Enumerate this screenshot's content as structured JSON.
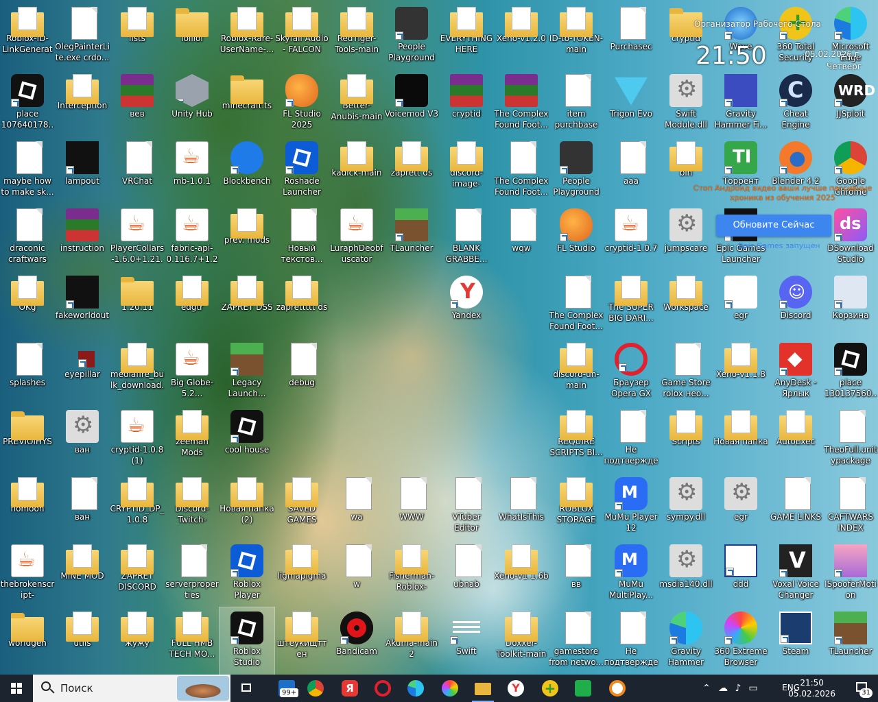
{
  "desktop": {
    "icons": [
      {
        "id": "c0r0",
        "label": "Roblox-ID-LinkGenerato...",
        "kind": "folderdoc"
      },
      {
        "id": "c0r1",
        "label": "place 107640178...",
        "kind": "roblox"
      },
      {
        "id": "c0r2",
        "label": "maybe how to make sk...",
        "kind": "file"
      },
      {
        "id": "c0r3",
        "label": "draconic craftwars",
        "kind": "file"
      },
      {
        "id": "c0r4",
        "label": "OKg",
        "kind": "folderdoc"
      },
      {
        "id": "c0r5",
        "label": "splashes",
        "kind": "file"
      },
      {
        "id": "c0r6",
        "label": "PREVIOIHYS",
        "kind": "folder"
      },
      {
        "id": "c0r7",
        "label": "nomoon",
        "kind": "folderdoc"
      },
      {
        "id": "c0r8",
        "label": "thebrokenscript-1.10.1m...",
        "kind": "java"
      },
      {
        "id": "c0r9",
        "label": "worldgen",
        "kind": "folder"
      },
      {
        "id": "c1r0",
        "label": "OlegPainterLite.exe crdo...",
        "kind": "file"
      },
      {
        "id": "c1r1",
        "label": "Interception",
        "kind": "folderdoc"
      },
      {
        "id": "c1r2",
        "label": "lampout",
        "kind": "dark"
      },
      {
        "id": "c1r3",
        "label": "instruction",
        "kind": "winrar"
      },
      {
        "id": "c1r4",
        "label": "fakeworldout",
        "kind": "dark"
      },
      {
        "id": "c1r5",
        "label": "eyepillar",
        "kind": "red"
      },
      {
        "id": "c1r6",
        "label": "ван",
        "kind": "gear"
      },
      {
        "id": "c1r7",
        "label": "ван",
        "kind": "file"
      },
      {
        "id": "c1r8",
        "label": "MINE MOD",
        "kind": "folderdoc"
      },
      {
        "id": "c1r9",
        "label": "utils",
        "kind": "folderdoc"
      },
      {
        "id": "c2r0",
        "label": "lists",
        "kind": "folderdoc"
      },
      {
        "id": "c2r1",
        "label": "вев",
        "kind": "winrar"
      },
      {
        "id": "c2r2",
        "label": "VRChat",
        "kind": "file"
      },
      {
        "id": "c2r3",
        "label": "PlayerCollars-1.6.0+1.21.4",
        "kind": "java"
      },
      {
        "id": "c2r4",
        "label": "1.20.11",
        "kind": "folder"
      },
      {
        "id": "c2r5",
        "label": "mediafire_bulk_download...",
        "kind": "folderdoc"
      },
      {
        "id": "c2r6",
        "label": "cryptid-1.0.8 (1)",
        "kind": "java"
      },
      {
        "id": "c2r7",
        "label": "CRYPTID_DP_1.0.8",
        "kind": "folderdoc"
      },
      {
        "id": "c2r8",
        "label": "ZAPRET DISCORD",
        "kind": "folderdoc"
      },
      {
        "id": "c2r9",
        "label": "жужу",
        "kind": "folderdoc"
      },
      {
        "id": "c3r0",
        "label": "lolllol",
        "kind": "folder"
      },
      {
        "id": "c3r1",
        "label": "Unity Hub",
        "kind": "unity"
      },
      {
        "id": "c3r2",
        "label": "mb-1.0.1",
        "kind": "java"
      },
      {
        "id": "c3r3",
        "label": "fabric-api-0.116.7+1.21.1",
        "kind": "java"
      },
      {
        "id": "c3r4",
        "label": "edgtr",
        "kind": "folderdoc"
      },
      {
        "id": "c3r5",
        "label": "Big Globe-5.2...",
        "kind": "java"
      },
      {
        "id": "c3r6",
        "label": "zeeman Mods",
        "kind": "folderdoc"
      },
      {
        "id": "c3r7",
        "label": "Discord-Twitch-Follow-...",
        "kind": "folderdoc"
      },
      {
        "id": "c3r8",
        "label": "serverproperties",
        "kind": "file"
      },
      {
        "id": "c3r9",
        "label": "FULL HMB TECH MO...",
        "kind": "folderdoc"
      },
      {
        "id": "c4r0",
        "label": "Roblox-Rare-UserName-...",
        "kind": "folderdoc"
      },
      {
        "id": "c4r1",
        "label": "minecraft.ts",
        "kind": "folder"
      },
      {
        "id": "c4r2",
        "label": "Blockbench",
        "kind": "blockbench"
      },
      {
        "id": "c4r3",
        "label": "prev. mods",
        "kind": "folderdoc"
      },
      {
        "id": "c4r4",
        "label": "ZAPRET DSS",
        "kind": "folderdoc"
      },
      {
        "id": "c4r5",
        "label": "Legacy Launch...",
        "kind": "mine"
      },
      {
        "id": "c4r6",
        "label": "cool house",
        "kind": "roblox"
      },
      {
        "id": "c4r7",
        "label": "Новая папка (2)",
        "kind": "folderdoc"
      },
      {
        "id": "c4r8",
        "label": "Roblox Player",
        "kind": "robloxblue"
      },
      {
        "id": "c4r9",
        "label": "Roblox Studio",
        "kind": "roblox",
        "selected": true
      },
      {
        "id": "c5r0",
        "label": "Skyfall Audio - FALCON",
        "kind": "folderdoc"
      },
      {
        "id": "c5r1",
        "label": "FL Studio 2025",
        "kind": "fl"
      },
      {
        "id": "c5r2",
        "label": "Roshade Launcher",
        "kind": "robloxblue"
      },
      {
        "id": "c5r3",
        "label": "Новый текстов...",
        "kind": "file"
      },
      {
        "id": "c5r4",
        "label": "zaprettttt ds",
        "kind": "folderdoc"
      },
      {
        "id": "c5r5",
        "label": "debug",
        "kind": "file"
      },
      {
        "id": "c5r7",
        "label": "SAVED GAMES",
        "kind": "folderdoc"
      },
      {
        "id": "c5r8",
        "label": "ligmapigma",
        "kind": "folderdoc"
      },
      {
        "id": "c5r9",
        "label": "штеукищттен",
        "kind": "folderdoc"
      },
      {
        "id": "c6r0",
        "label": "RedTiger-Tools-main",
        "kind": "folderdoc"
      },
      {
        "id": "c6r1",
        "label": "Better-Anubis-main",
        "kind": "folderdoc"
      },
      {
        "id": "c6r2",
        "label": "kadick-main",
        "kind": "folderdoc"
      },
      {
        "id": "c6r3",
        "label": "LuraphDeobfuscator",
        "kind": "java"
      },
      {
        "id": "c6r7",
        "label": "wa",
        "kind": "file"
      },
      {
        "id": "c6r8",
        "label": "w",
        "kind": "file"
      },
      {
        "id": "c6r9",
        "label": "Bandicam",
        "kind": "bandicam"
      },
      {
        "id": "c7r0",
        "label": "People Playground",
        "kind": "pp"
      },
      {
        "id": "c7r1",
        "label": "Voicemod V3",
        "kind": "voicemod"
      },
      {
        "id": "c7r2",
        "label": "zaprett ds",
        "kind": "folderdoc"
      },
      {
        "id": "c7r3",
        "label": "TLauncher",
        "kind": "mine"
      },
      {
        "id": "c7r7",
        "label": "WWW",
        "kind": "file"
      },
      {
        "id": "c7r8",
        "label": "Fisherman-Roblox-doxe...",
        "kind": "folderdoc"
      },
      {
        "id": "c7r9",
        "label": "Akuma-main 2",
        "kind": "folderdoc"
      },
      {
        "id": "c8r0",
        "label": "EVERYTHING HERE",
        "kind": "folderdoc"
      },
      {
        "id": "c8r1",
        "label": "cryptid",
        "kind": "winrar"
      },
      {
        "id": "c8r2",
        "label": "discord-image-logger-m...",
        "kind": "folderdoc"
      },
      {
        "id": "c8r3",
        "label": "BLANK GRABBE...",
        "kind": "file"
      },
      {
        "id": "c8r4",
        "label": "Yandex",
        "kind": "yandex"
      },
      {
        "id": "c8r7",
        "label": "VTuber Editor",
        "kind": "file"
      },
      {
        "id": "c8r8",
        "label": "ubnab",
        "kind": "file"
      },
      {
        "id": "c8r9",
        "label": "Swift",
        "kind": "swift"
      },
      {
        "id": "c9r0",
        "label": "Xeno-v1.2.0",
        "kind": "folderdoc"
      },
      {
        "id": "c9r1",
        "label": "The Complex Found Foot...",
        "kind": "winrar"
      },
      {
        "id": "c9r2",
        "label": "The Complex Found Foot...",
        "kind": "file"
      },
      {
        "id": "c9r3",
        "label": "wqw",
        "kind": "file"
      },
      {
        "id": "c9r7",
        "label": "WhatIsThis",
        "kind": "file"
      },
      {
        "id": "c9r8",
        "label": "Xeno-v1.1.6b",
        "kind": "folderdoc"
      },
      {
        "id": "c9r9",
        "label": "Doxxer-Toolkit-main",
        "kind": "folderdoc"
      },
      {
        "id": "c10r0",
        "label": "ID-to-TOKEN-main",
        "kind": "folderdoc"
      },
      {
        "id": "c10r1",
        "label": "item purchbase",
        "kind": "file"
      },
      {
        "id": "c10r2",
        "label": "People Playground",
        "kind": "pp"
      },
      {
        "id": "c10r3",
        "label": "FL Studio",
        "kind": "fl"
      },
      {
        "id": "c10r4",
        "label": "The Complex Found Foot...",
        "kind": "file"
      },
      {
        "id": "c10r5",
        "label": "discord-un-main",
        "kind": "folderdoc"
      },
      {
        "id": "c10r6",
        "label": "REQUIRE SCRIPTS BI...",
        "kind": "folderdoc"
      },
      {
        "id": "c10r7",
        "label": "ROBLOX STORAGE",
        "kind": "folderdoc"
      },
      {
        "id": "c10r8",
        "label": "вв",
        "kind": "file"
      },
      {
        "id": "c10r9",
        "label": "gamestore from netwo...",
        "kind": "file"
      },
      {
        "id": "c11r0",
        "label": "Purchasec",
        "kind": "file"
      },
      {
        "id": "c11r1",
        "label": "Trigon Evo",
        "kind": "trigon"
      },
      {
        "id": "c11r2",
        "label": "ааа",
        "kind": "file"
      },
      {
        "id": "c11r3",
        "label": "cryptid-1.0.7",
        "kind": "java"
      },
      {
        "id": "c11r4",
        "label": "The SUPER BIG DARI...",
        "kind": "folderdoc"
      },
      {
        "id": "c11r5",
        "label": "Браузер Opera GX",
        "kind": "opera"
      },
      {
        "id": "c11r6",
        "label": "Не подтверждено 866153",
        "kind": "file"
      },
      {
        "id": "c11r7",
        "label": "MuMu Player 12",
        "kind": "mumu"
      },
      {
        "id": "c11r8",
        "label": "MuMu MultiPlay...",
        "kind": "mumu"
      },
      {
        "id": "c11r9",
        "label": "Не подтверждено 407231...",
        "kind": "file"
      },
      {
        "id": "c12r0",
        "label": "cryptid",
        "kind": "folder"
      },
      {
        "id": "c12r1",
        "label": "Swift Module.dll",
        "kind": "gear"
      },
      {
        "id": "c12r2",
        "label": "bin",
        "kind": "folderdoc"
      },
      {
        "id": "c12r3",
        "label": "jumpscare",
        "kind": "gear"
      },
      {
        "id": "c12r4",
        "label": "Workspace",
        "kind": "folderdoc"
      },
      {
        "id": "c12r5",
        "label": "Game Store rolox нео...",
        "kind": "file"
      },
      {
        "id": "c12r6",
        "label": "Scripts",
        "kind": "folderdoc"
      },
      {
        "id": "c12r7",
        "label": "sympy.dll",
        "kind": "gear"
      },
      {
        "id": "c12r8",
        "label": "msdia140.dll",
        "kind": "gear"
      },
      {
        "id": "c12r9",
        "label": "Gravity Hammer",
        "kind": "edge"
      },
      {
        "id": "c13r0",
        "label": "Wave",
        "kind": "wave"
      },
      {
        "id": "c13r1",
        "label": "Gravity Hammer Fi...",
        "kind": "gravity"
      },
      {
        "id": "c13r2",
        "label": "Торрент",
        "kind": "torrent"
      },
      {
        "id": "c13r3",
        "label": "Epic Games Launcher",
        "kind": "dark"
      },
      {
        "id": "c13r4",
        "label": "egr",
        "kind": "chromeapp"
      },
      {
        "id": "c13r5",
        "label": "Xeno-v1.1.8",
        "kind": "folderdoc"
      },
      {
        "id": "c13r6",
        "label": "Новая папка",
        "kind": "folderdoc"
      },
      {
        "id": "c13r7",
        "label": "egr",
        "kind": "gear"
      },
      {
        "id": "c13r8",
        "label": "ddd",
        "kind": "window"
      },
      {
        "id": "c13r9",
        "label": "360 Extreme Browser",
        "kind": "x360"
      },
      {
        "id": "c14r0",
        "label": "360 Total Security",
        "kind": "t360"
      },
      {
        "id": "c14r1",
        "label": "Cheat Engine",
        "kind": "cheat"
      },
      {
        "id": "c14r2",
        "label": "Blender 4.2",
        "kind": "blender"
      },
      {
        "id": "c14r4",
        "label": "Discord",
        "kind": "discord"
      },
      {
        "id": "c14r5",
        "label": "AnyDesk - Ярлык",
        "kind": "anydesk"
      },
      {
        "id": "c14r6",
        "label": "AutoExec",
        "kind": "folderdoc"
      },
      {
        "id": "c14r7",
        "label": "GAME LINKS",
        "kind": "file"
      },
      {
        "id": "c14r8",
        "label": "Voxal Voice Changer",
        "kind": "voxal"
      },
      {
        "id": "c14r9",
        "label": "Steam",
        "kind": "steam"
      },
      {
        "id": "c15r0",
        "label": "Microsoft Edge",
        "kind": "edge"
      },
      {
        "id": "c15r1",
        "label": "JJSploit",
        "kind": "jj"
      },
      {
        "id": "c15r2",
        "label": "Google Chrome",
        "kind": "chrome"
      },
      {
        "id": "c15r3",
        "label": "DSownload Studio",
        "kind": "ds"
      },
      {
        "id": "c15r4",
        "label": "Корзина",
        "kind": "bin"
      },
      {
        "id": "c15r5",
        "label": "place 130137560...",
        "kind": "roblox"
      },
      {
        "id": "c15r6",
        "label": "TheoFull.unitypackage",
        "kind": "file"
      },
      {
        "id": "c15r7",
        "label": "CAFTWARS INDEX",
        "kind": "file"
      },
      {
        "id": "c15r8",
        "label": "ISpooferMotion",
        "kind": "spoofer"
      },
      {
        "id": "c15r9",
        "label": "TLauncher",
        "kind": "mine"
      }
    ]
  },
  "widget": {
    "title": "Организатор Рабочего Стола",
    "time": "21:50",
    "date": "05.02.2026 г.",
    "day": "Четверг"
  },
  "notices": {
    "torrent": "Стоп Андроид видео ваши лучше пассивные хроника из обучения 2025",
    "update_button": "Обновите Сейчас",
    "epic": "Epic Games запущен"
  },
  "taskbar": {
    "search_placeholder": "Поиск",
    "mail_badge": "99+",
    "lang": "ENG",
    "time": "21:50",
    "date": "05.02.2026",
    "notify_count": "31",
    "apps": [
      "task-view",
      "mail",
      "chrome",
      "yandex-browser",
      "opera",
      "edge",
      "chrome-alt",
      "file-explorer",
      "yandex",
      "360-total",
      "greenhouse",
      "bandicam-alt"
    ]
  },
  "colors": {
    "taskbar_bg": "#1c2430",
    "update_button": "#3d86f0",
    "torrent_note": "#ff7a1a",
    "folder": "#e8b63e"
  }
}
